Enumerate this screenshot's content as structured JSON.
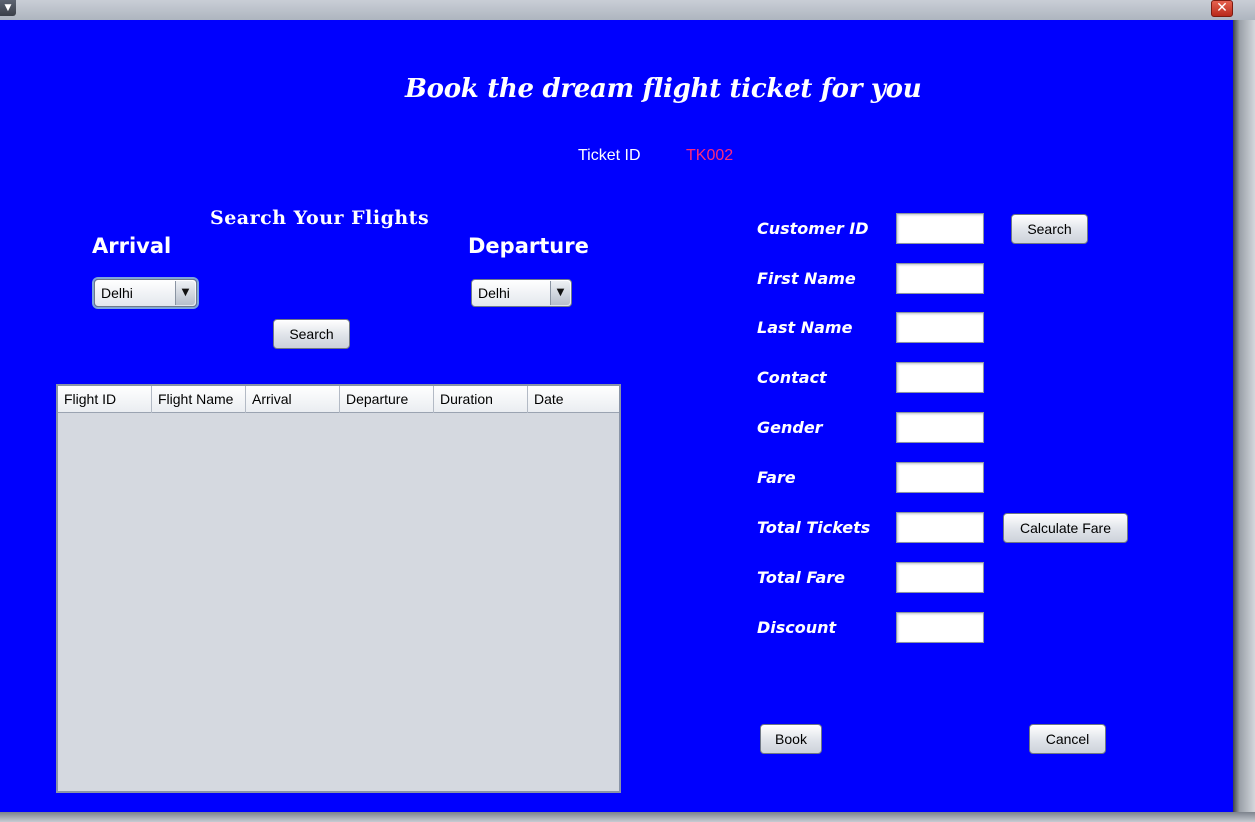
{
  "window": {
    "menu_icon": "chevron-down-icon",
    "close_glyph": "✕",
    "background_color": "#0000FE"
  },
  "header": {
    "title": "Book the dream flight ticket for you",
    "ticket_id_label": "Ticket ID",
    "ticket_id_value": "TK002"
  },
  "search": {
    "heading": "Search Your Flights",
    "arrival_label": "Arrival",
    "departure_label": "Departure",
    "arrival_selected": "Delhi",
    "departure_selected": "Delhi",
    "search_button": "Search"
  },
  "table": {
    "columns": [
      "Flight ID",
      "Flight Name",
      "Arrival",
      "Departure",
      "Duration",
      "Date"
    ],
    "rows": []
  },
  "form": {
    "fields": [
      {
        "label": "Customer ID",
        "value": ""
      },
      {
        "label": "First Name",
        "value": ""
      },
      {
        "label": "Last Name",
        "value": ""
      },
      {
        "label": "Contact",
        "value": ""
      },
      {
        "label": "Gender",
        "value": ""
      },
      {
        "label": "Fare",
        "value": ""
      },
      {
        "label": "Total Tickets",
        "value": ""
      },
      {
        "label": "Total Fare",
        "value": ""
      },
      {
        "label": "Discount",
        "value": ""
      }
    ],
    "customer_search_button": "Search",
    "calculate_fare_button": "Calculate Fare",
    "book_button": "Book",
    "cancel_button": "Cancel"
  }
}
